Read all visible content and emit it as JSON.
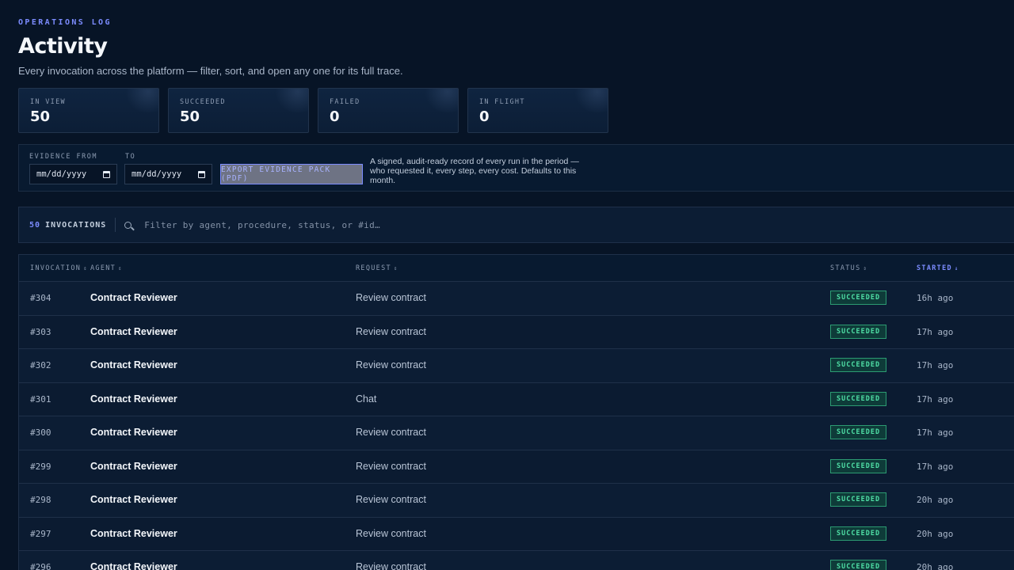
{
  "header": {
    "eyebrow": "OPERATIONS LOG",
    "title": "Activity",
    "subtitle": "Every invocation across the platform — filter, sort, and open any one for its full trace."
  },
  "stats": [
    {
      "label": "IN VIEW",
      "value": "50"
    },
    {
      "label": "SUCCEEDED",
      "value": "50"
    },
    {
      "label": "FAILED",
      "value": "0"
    },
    {
      "label": "IN FLIGHT",
      "value": "0"
    }
  ],
  "evidence": {
    "from_label": "EVIDENCE FROM",
    "to_label": "TO",
    "from_value": "mm/dd/yyyy",
    "to_value": "mm/dd/yyyy",
    "export_label": "EXPORT EVIDENCE PACK (PDF)",
    "help": "A signed, audit-ready record of every run in the period — who requested it, every step, every cost. Defaults to this month."
  },
  "filter": {
    "count": "50",
    "count_label": "INVOCATIONS",
    "placeholder": "Filter by agent, procedure, status, or #id…"
  },
  "table": {
    "columns": {
      "invocation": "INVOCATION",
      "agent": "AGENT",
      "request": "REQUEST",
      "status": "STATUS",
      "started": "STARTED"
    },
    "sort_icons": {
      "inactive": "⇕",
      "active": "↓"
    },
    "rows": [
      {
        "id": "#304",
        "agent": "Contract Reviewer",
        "request": "Review contract",
        "status": "SUCCEEDED",
        "started": "16h ago"
      },
      {
        "id": "#303",
        "agent": "Contract Reviewer",
        "request": "Review contract",
        "status": "SUCCEEDED",
        "started": "17h ago"
      },
      {
        "id": "#302",
        "agent": "Contract Reviewer",
        "request": "Review contract",
        "status": "SUCCEEDED",
        "started": "17h ago"
      },
      {
        "id": "#301",
        "agent": "Contract Reviewer",
        "request": "Chat",
        "status": "SUCCEEDED",
        "started": "17h ago"
      },
      {
        "id": "#300",
        "agent": "Contract Reviewer",
        "request": "Review contract",
        "status": "SUCCEEDED",
        "started": "17h ago"
      },
      {
        "id": "#299",
        "agent": "Contract Reviewer",
        "request": "Review contract",
        "status": "SUCCEEDED",
        "started": "17h ago"
      },
      {
        "id": "#298",
        "agent": "Contract Reviewer",
        "request": "Review contract",
        "status": "SUCCEEDED",
        "started": "20h ago"
      },
      {
        "id": "#297",
        "agent": "Contract Reviewer",
        "request": "Review contract",
        "status": "SUCCEEDED",
        "started": "20h ago"
      },
      {
        "id": "#296",
        "agent": "Contract Reviewer",
        "request": "Review contract",
        "status": "SUCCEEDED",
        "started": "20h ago"
      }
    ]
  },
  "colors": {
    "accent": "#7c8cff",
    "success": "#4fe0a6",
    "background": "#071426"
  }
}
